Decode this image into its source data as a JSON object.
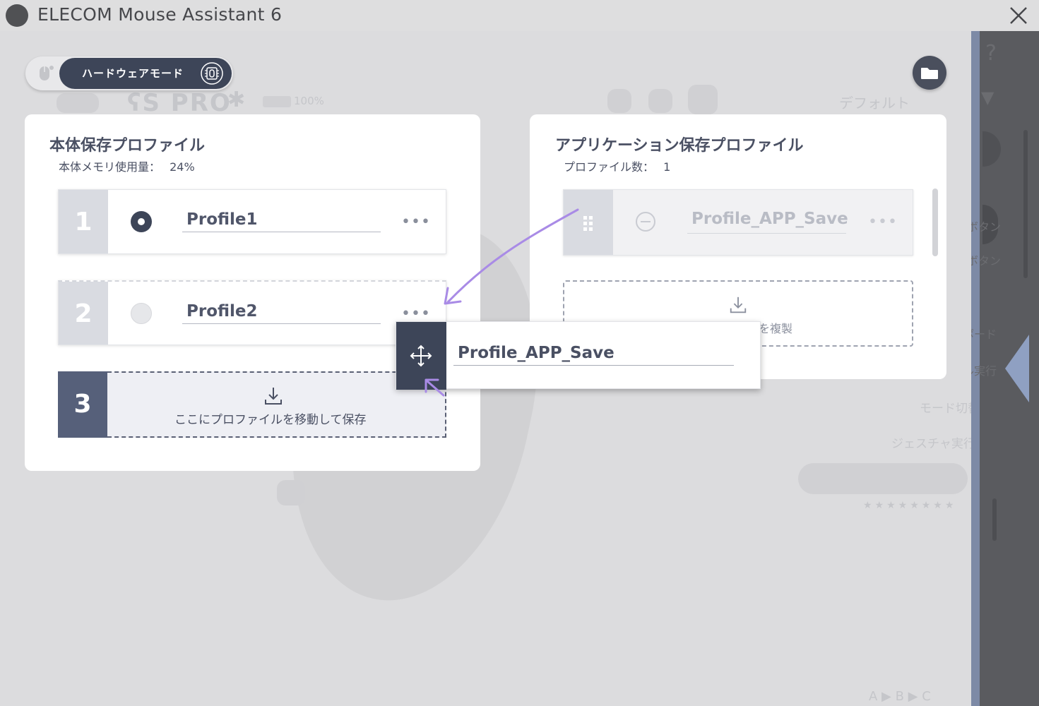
{
  "window": {
    "title": "ELECOM Mouse Assistant 6",
    "close_glyph": "╳"
  },
  "background_app": {
    "battery": "100%",
    "preset": "デフォルト",
    "side_items": [
      "ボタン",
      "ボタン",
      "ボード",
      "ル実行",
      "モード切替",
      "ジェスチャ実行"
    ],
    "ghost_text": "A ▶ B ▶ C"
  },
  "mode_toggle": {
    "label": "ハードウェアモード",
    "active_mode": "hardware"
  },
  "device_profiles": {
    "title": "本体保存プロファイル",
    "memory_label": "本体メモリ使用量：",
    "memory_value": "24%",
    "slots": [
      {
        "number": "1",
        "name": "Profile1",
        "selected": true,
        "menu": "•••"
      },
      {
        "number": "2",
        "name": "Profile2",
        "selected": false,
        "menu": "•••"
      }
    ],
    "empty_slot": {
      "number": "3",
      "hint": "ここにプロファイルを移動して保存"
    }
  },
  "app_profiles": {
    "title": "アプリケーション保存プロファイル",
    "count_label": "プロファイル数：",
    "count_value": "1",
    "items": [
      {
        "name": "Profile_APP_Save",
        "menu": "•••"
      }
    ],
    "duplicate_hint": "を複製"
  },
  "drag_item": {
    "name": "Profile_APP_Save"
  },
  "colors": {
    "accent_dark": "#3d4558",
    "arrow": "#a98be6",
    "card_bg": "#ffffff",
    "sidebar_strip": "#7d8aa6"
  }
}
